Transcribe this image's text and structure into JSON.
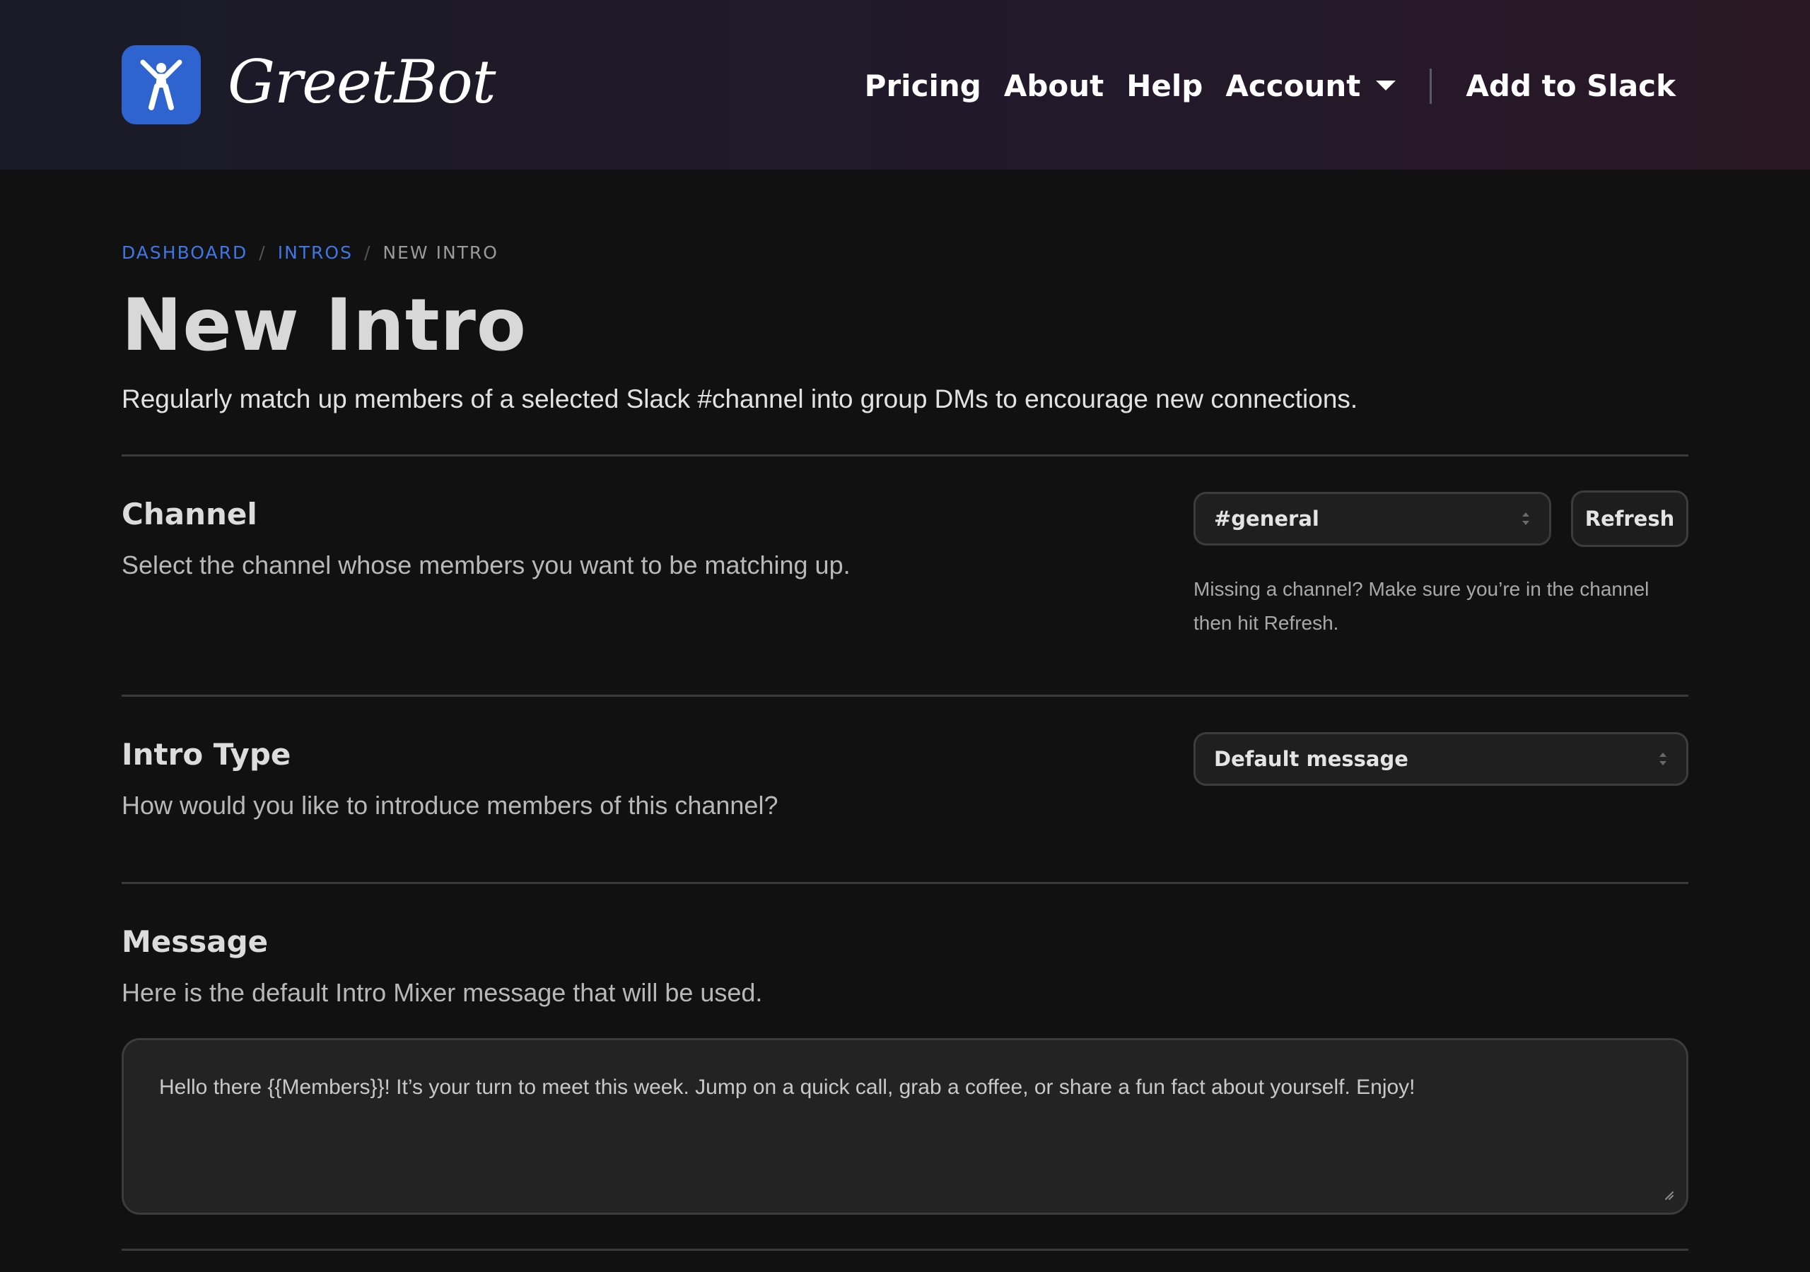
{
  "header": {
    "logo_text": "GreetBot",
    "nav": [
      {
        "label": "Pricing"
      },
      {
        "label": "About"
      },
      {
        "label": "Help"
      },
      {
        "label": "Account"
      }
    ],
    "cta_label": "Add to Slack"
  },
  "breadcrumb": {
    "items": [
      "DASHBOARD",
      "INTROS"
    ],
    "current": "NEW INTRO",
    "separator": "/"
  },
  "page": {
    "title": "New Intro",
    "description": "Regularly match up members of a selected Slack #channel into group DMs to encourage new connections."
  },
  "channel_section": {
    "title": "Channel",
    "description": "Select the channel whose members you want to be matching up.",
    "selected_value": "#general",
    "refresh_label": "Refresh",
    "help_text": "Missing a channel? Make sure you’re in the channel then hit Refresh."
  },
  "intro_type_section": {
    "title": "Intro Type",
    "description": "How would you like to introduce members of this channel?",
    "selected_value": "Default message"
  },
  "message_section": {
    "title": "Message",
    "description": "Here is the default Intro Mixer message that will be used.",
    "message_value": "Hello there {{Members}}! It’s your turn to meet this week. Jump on a quick call, grab a coffee, or share a fun fact about yourself. Enjoy!"
  },
  "colors": {
    "brand_blue": "#2f63cf",
    "link_blue": "#3f76e3",
    "background": "#111111"
  },
  "icons": {
    "logo": "person-arms-raised-icon",
    "account_menu": "caret-down-icon",
    "select": "select-arrows-icon",
    "textarea": "resize-grip-icon"
  }
}
